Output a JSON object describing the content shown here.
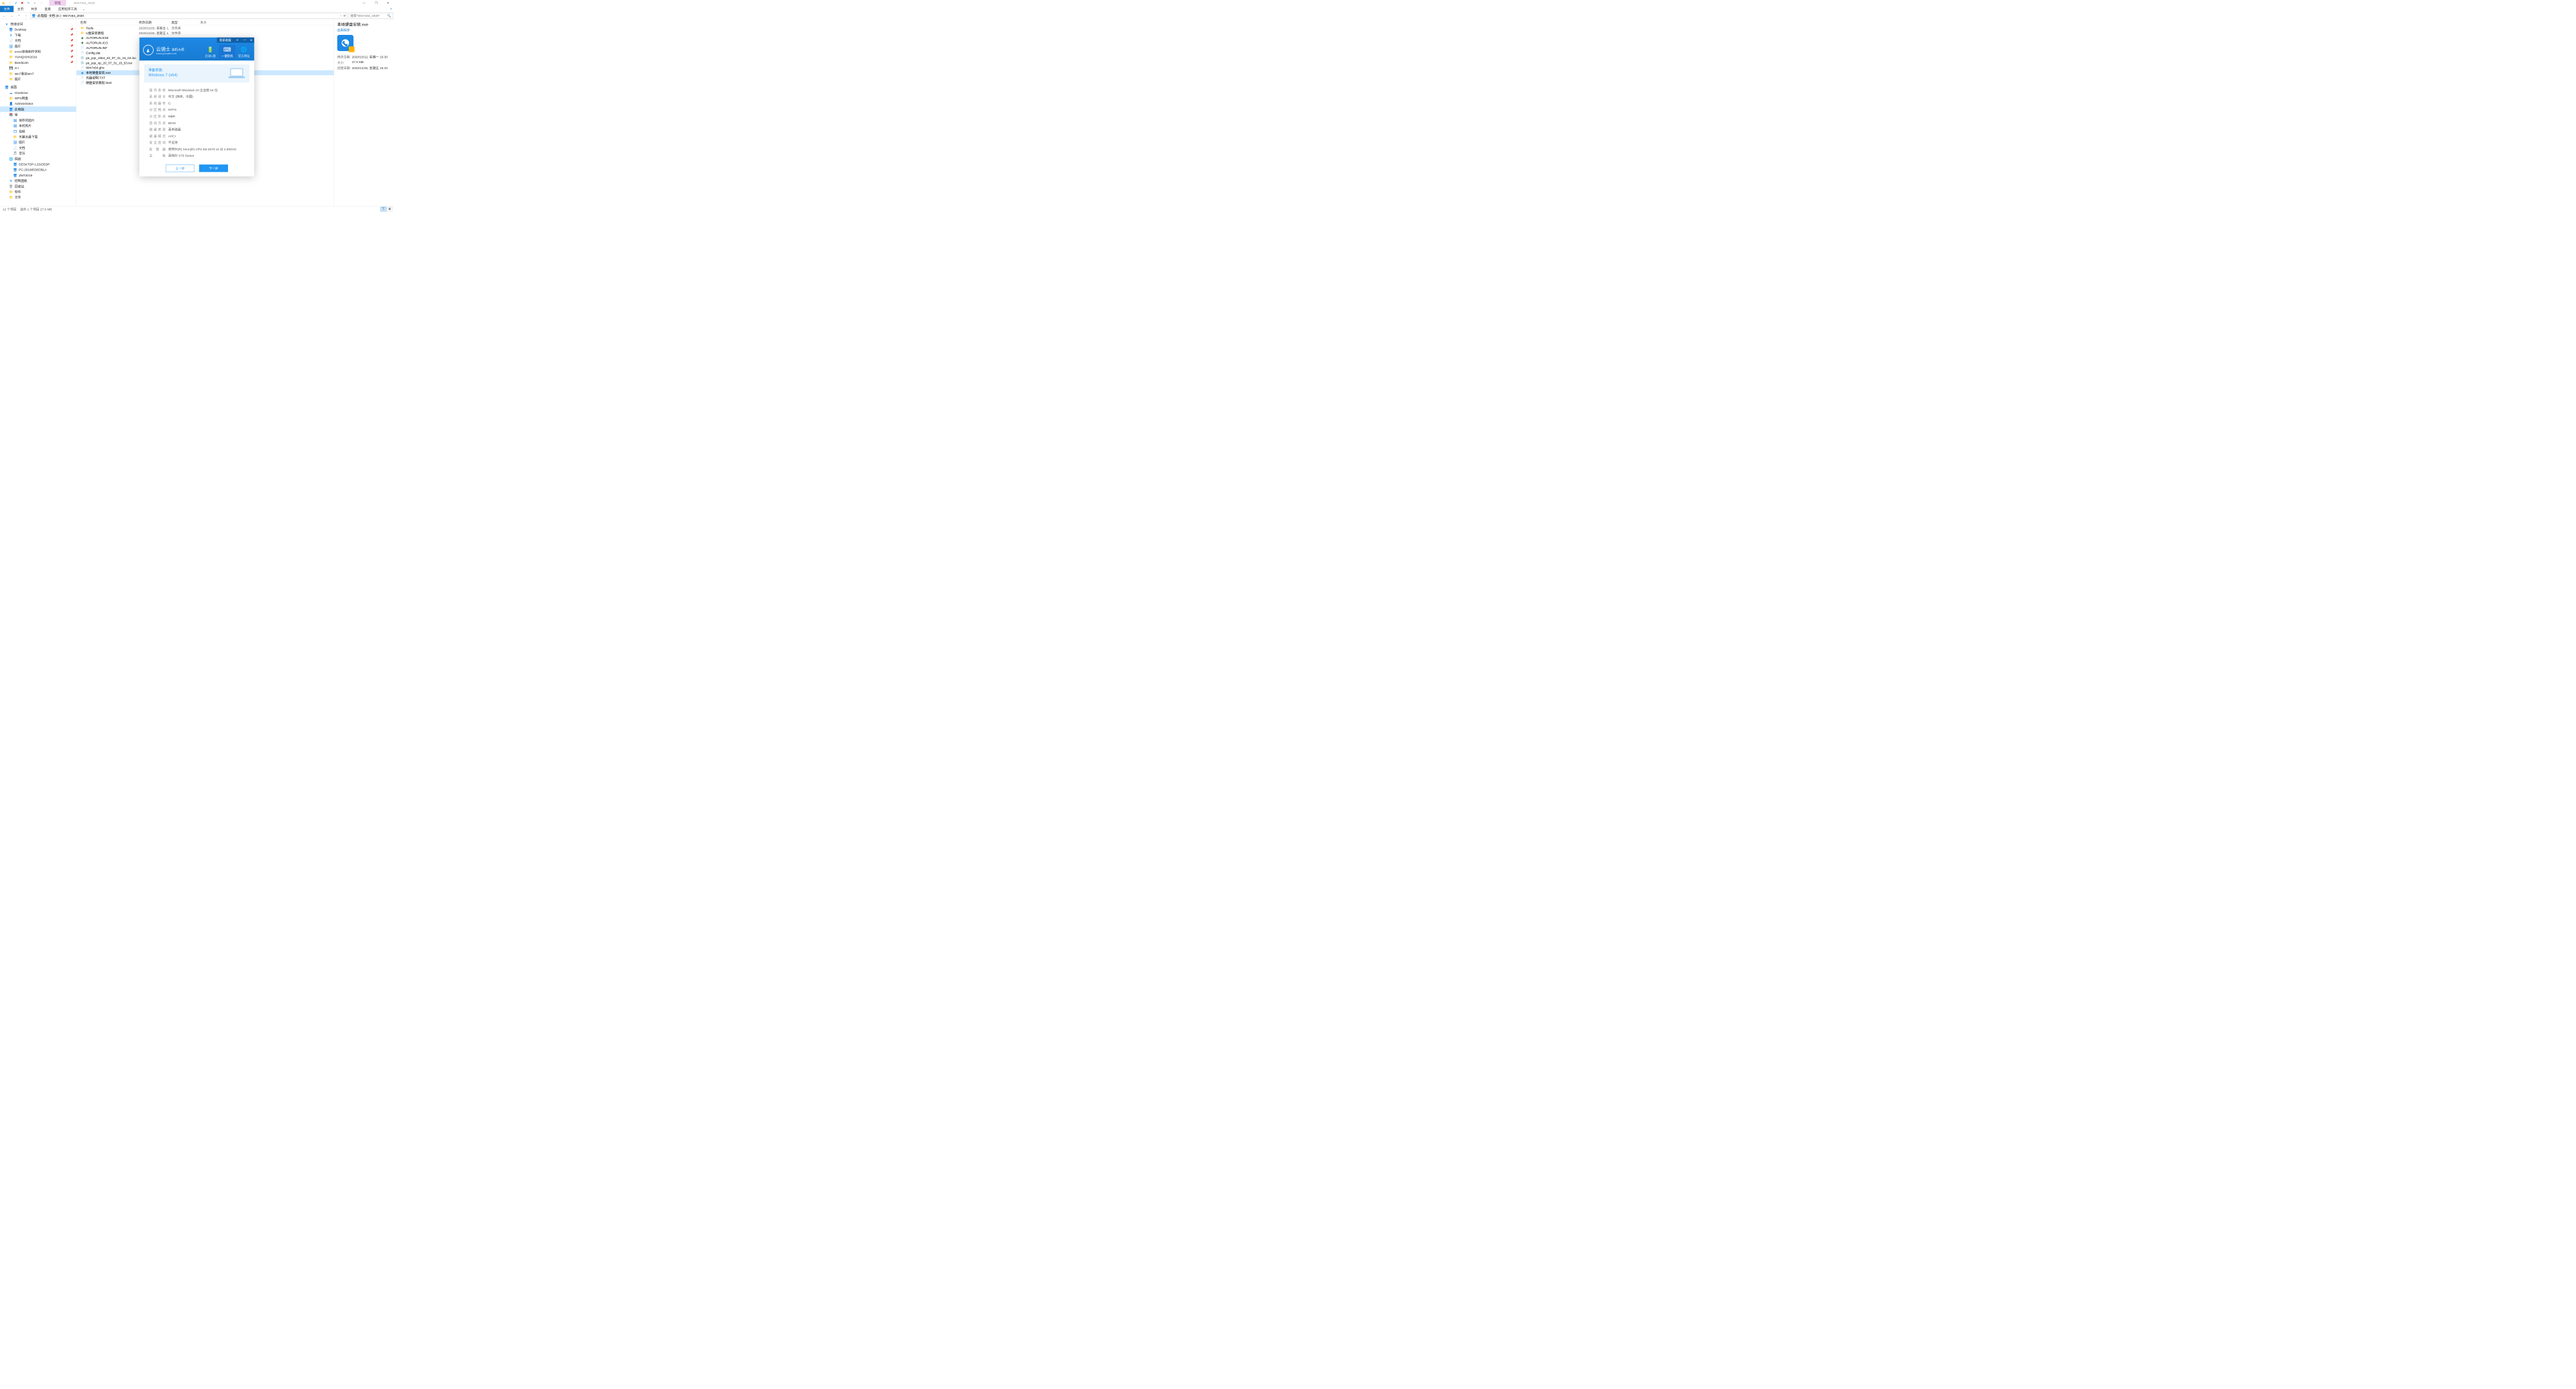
{
  "window": {
    "title": "Win7x64_2020",
    "manage_tab": "管理"
  },
  "ribbon": {
    "file": "文件",
    "home": "主页",
    "share": "共享",
    "view": "查看",
    "apptools": "应用程序工具"
  },
  "nav": {
    "crumbs": [
      "此电脑",
      "文档 (E:)",
      "Win7x64_2020"
    ],
    "search_placeholder": "搜索\"Win7x64_2020\""
  },
  "tree": {
    "quick": "快速访问",
    "quick_items": [
      {
        "label": "Desktop",
        "ico": "🖥",
        "c": "#1e88e5"
      },
      {
        "label": "下载",
        "ico": "⬇",
        "c": "#1e88e5"
      },
      {
        "label": "文档",
        "ico": "📄",
        "c": "#1e88e5"
      },
      {
        "label": "图片",
        "ico": "🖼",
        "c": "#1e88e5"
      },
      {
        "label": "excel表格制作求和",
        "ico": "📁",
        "c": "#f7c04a"
      },
      {
        "label": "YUNQISHI2019",
        "ico": "📁",
        "c": "#f7c04a"
      },
      {
        "label": "Bandicam",
        "ico": "📁",
        "c": "#f7c04a"
      },
      {
        "label": "G:\\",
        "ico": "💾",
        "c": "#888"
      },
      {
        "label": "win7重装win7",
        "ico": "📁",
        "c": "#f7c04a"
      },
      {
        "label": "图片",
        "ico": "📁",
        "c": "#f7c04a"
      }
    ],
    "desktop": "桌面",
    "desktop_items": [
      {
        "label": "OneDrive",
        "ico": "☁",
        "c": "#1e88e5"
      },
      {
        "label": "WPS网盘",
        "ico": "📁",
        "c": "#f5a623"
      },
      {
        "label": "Administrator",
        "ico": "👤",
        "c": "#f5a623"
      },
      {
        "label": "此电脑",
        "ico": "🖥",
        "c": "#1e88e5",
        "sel": true
      },
      {
        "label": "库",
        "ico": "📚",
        "c": "#f5a623"
      }
    ],
    "lib_items": [
      {
        "label": "保存的图片",
        "ico": "🖼",
        "c": "#1e88e5"
      },
      {
        "label": "本机照片",
        "ico": "🖼",
        "c": "#1e88e5"
      },
      {
        "label": "视频",
        "ico": "🎞",
        "c": "#1e88e5"
      },
      {
        "label": "天翼云盘下载",
        "ico": "📁",
        "c": "#1e88e5"
      },
      {
        "label": "图片",
        "ico": "🖼",
        "c": "#1e88e5"
      },
      {
        "label": "文档",
        "ico": "📄",
        "c": "#1e88e5"
      },
      {
        "label": "音乐",
        "ico": "🎵",
        "c": "#1e88e5"
      }
    ],
    "net": "网络",
    "net_items": [
      {
        "label": "DESKTOP-LSSOEDP",
        "ico": "🖥",
        "c": "#1e88e5"
      },
      {
        "label": "PC-20190530OBLA",
        "ico": "🖥",
        "c": "#1e88e5"
      },
      {
        "label": "ZMT2019",
        "ico": "🖥",
        "c": "#1e88e5"
      }
    ],
    "tail": [
      {
        "label": "控制面板",
        "ico": "⚙",
        "c": "#1e88e5"
      },
      {
        "label": "回收站",
        "ico": "🗑",
        "c": "#888"
      },
      {
        "label": "软件",
        "ico": "📁",
        "c": "#f7c04a"
      },
      {
        "label": "文件",
        "ico": "📁",
        "c": "#f7c04a"
      }
    ]
  },
  "cols": {
    "name": "名称",
    "date": "修改日期",
    "type": "类型",
    "size": "大小"
  },
  "files": [
    {
      "name": "Tools",
      "date": "2020/12/25, 星期五 1...",
      "type": "文件夹",
      "ico": "📁",
      "c": "#f7c04a"
    },
    {
      "name": "U盘安装教程",
      "date": "2020/12/25, 星期五 1...",
      "type": "文件夹",
      "ico": "📁",
      "c": "#f7c04a"
    },
    {
      "name": "AUTORUN.EXE",
      "date": "",
      "type": "",
      "ico": "◆",
      "c": "#2e7d32"
    },
    {
      "name": "AUTORUN.ICO",
      "date": "",
      "type": "",
      "ico": "◆",
      "c": "#2e7d32"
    },
    {
      "name": "AUTORUN.INF",
      "date": "",
      "type": "",
      "ico": "📄",
      "c": "#888"
    },
    {
      "name": "Config.dat",
      "date": "",
      "type": "",
      "ico": "📄",
      "c": "#888"
    },
    {
      "name": "pe_yqs_1064_20_07_31_16_04.iso",
      "date": "",
      "type": "",
      "ico": "💿",
      "c": "#888"
    },
    {
      "name": "pe_yqs_xp_20_07_31_15_53.iso",
      "date": "",
      "type": "",
      "ico": "💿",
      "c": "#888"
    },
    {
      "name": "Win7x64.gho",
      "date": "",
      "type": "",
      "ico": "📄",
      "c": "#888"
    },
    {
      "name": "本地硬盘安装.exe",
      "date": "",
      "type": "",
      "ico": "◉",
      "c": "#1e88e5",
      "sel": true
    },
    {
      "name": "光盘说明.TXT",
      "date": "",
      "type": "",
      "ico": "📄",
      "c": "#888"
    },
    {
      "name": "硬盘安装教程.html",
      "date": "",
      "type": "",
      "ico": "📄",
      "c": "#888"
    }
  ],
  "rpane": {
    "title": "本地硬盘安装.exe",
    "sub": "应用程序",
    "props": [
      {
        "k": "修改日期:",
        "v": "2020/10/12, 星期一 15:30"
      },
      {
        "k": "大小:",
        "v": "27.6 MB"
      },
      {
        "k": "创建日期:",
        "v": "2020/12/25, 星期五 16:33"
      }
    ]
  },
  "status": {
    "count": "12 个项目",
    "sel": "选中 1 个项目  27.6 MB"
  },
  "installer": {
    "contact": "联系客服",
    "brand_big": "云骑士",
    "brand_suffix": "装机大师",
    "brand_url": "www.yunqishi.net",
    "tabs": [
      "启动U盘",
      "一键装机",
      "官方网址"
    ],
    "banner_t": "准备安装:",
    "banner_os": "Windows 7 (x64)",
    "info": [
      {
        "k": "操作系统",
        "v": "Microsoft Windows 10 企业版 64 位"
      },
      {
        "k": "系统语言",
        "v": "中文 (简体，中国)"
      },
      {
        "k": "系统盘符",
        "v": "C:"
      },
      {
        "k": "分区格式",
        "v": "NTFS"
      },
      {
        "k": "分区形式",
        "v": "MBR"
      },
      {
        "k": "启动方式",
        "v": "BIOS"
      },
      {
        "k": "磁盘类型",
        "v": "基本磁盘"
      },
      {
        "k": "磁盘模式",
        "v": "AHCI"
      },
      {
        "k": "安全启动",
        "v": "不支持"
      },
      {
        "k": "处理器",
        "v": "英特尔(R) Xeon(R) CPU E5-2670 v2 @ 2.50GHz"
      },
      {
        "k": "主板",
        "v": "英特尔 X79 Series"
      }
    ],
    "btn_prev": "上一步",
    "btn_next": "下一步"
  }
}
